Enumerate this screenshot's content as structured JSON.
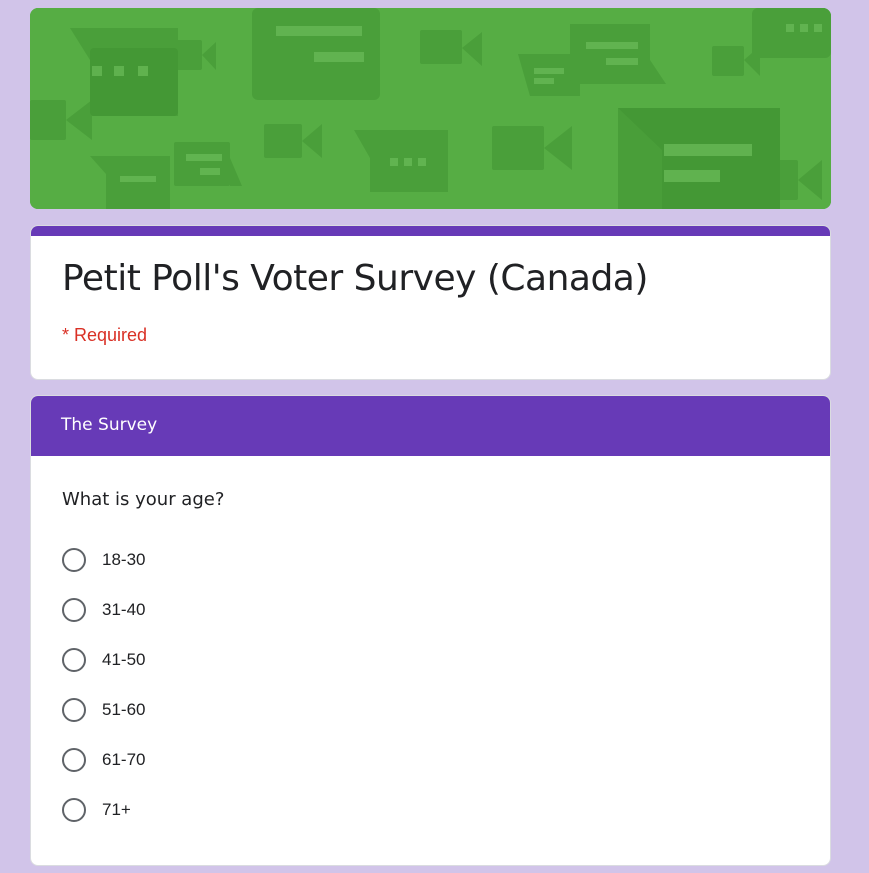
{
  "form": {
    "title": "Petit Poll's Voter Survey (Canada)",
    "required_note": "* Required"
  },
  "section": {
    "title": "The Survey",
    "question": "What is your age?",
    "options": [
      "18-30",
      "31-40",
      "41-50",
      "51-60",
      "61-70",
      "71+"
    ]
  },
  "colors": {
    "background": "#d1c4e9",
    "accent": "#673ab7",
    "banner": "#56ad44",
    "required": "#d93025"
  }
}
